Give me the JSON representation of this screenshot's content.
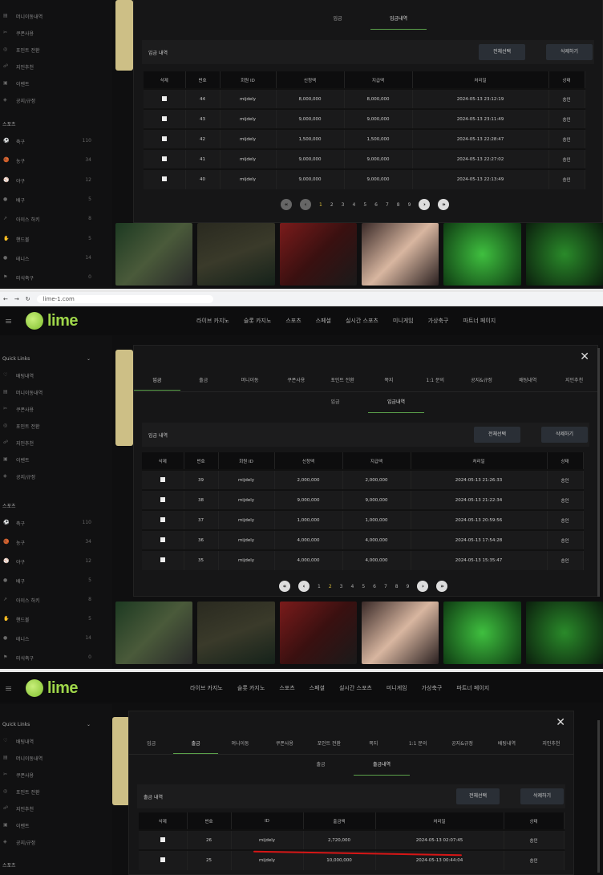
{
  "browser": {
    "url": "lime-1.com"
  },
  "brand": {
    "name": "lime"
  },
  "topnav": [
    "라이브 카지노",
    "슬롯 카지노",
    "스포츠",
    "스페셜",
    "실시간 스포츠",
    "미니게임",
    "가상축구",
    "파트너 페이지"
  ],
  "sidebar": {
    "quick_links": "Quick Links",
    "links": [
      "배팅내역",
      "머니이동내역",
      "쿠폰사용",
      "포인트 전환",
      "지인추천",
      "이벤트",
      "공지/규정"
    ],
    "sports_header": "스포츠",
    "sports": [
      {
        "name": "축구",
        "count": "110"
      },
      {
        "name": "농구",
        "count": "34"
      },
      {
        "name": "야구",
        "count": "12"
      },
      {
        "name": "배구",
        "count": "5"
      },
      {
        "name": "아이스 하키",
        "count": "8"
      },
      {
        "name": "핸드볼",
        "count": "5"
      },
      {
        "name": "테니스",
        "count": "14"
      },
      {
        "name": "미식축구",
        "count": "0"
      }
    ]
  },
  "modal_tabs": [
    "입금",
    "출금",
    "머니이동",
    "쿠폰사용",
    "포인트 전환",
    "쪽지",
    "1:1 문의",
    "공지&규정",
    "배팅내역",
    "지인추천"
  ],
  "deposit": {
    "subtabs": [
      "입금",
      "입금내역"
    ],
    "card_title": "입금 내역",
    "select_all": "전체선택",
    "delete": "삭제하기",
    "columns": [
      "삭제",
      "번호",
      "회원 ID",
      "신청액",
      "지급액",
      "처리일",
      "상태"
    ]
  },
  "panel1_rows": [
    {
      "no": "44",
      "id": "mijdely",
      "req": "8,000,000",
      "paid": "8,000,000",
      "date": "2024-05-13 23:12:19",
      "status": "승인"
    },
    {
      "no": "43",
      "id": "mijdely",
      "req": "9,000,000",
      "paid": "9,000,000",
      "date": "2024-05-13 23:11:49",
      "status": "승인"
    },
    {
      "no": "42",
      "id": "mijdely",
      "req": "1,500,000",
      "paid": "1,500,000",
      "date": "2024-05-13 22:28:47",
      "status": "승인"
    },
    {
      "no": "41",
      "id": "mijdely",
      "req": "9,000,000",
      "paid": "9,000,000",
      "date": "2024-05-13 22:27:02",
      "status": "승인"
    },
    {
      "no": "40",
      "id": "mijdely",
      "req": "9,000,000",
      "paid": "9,000,000",
      "date": "2024-05-13 22:13:49",
      "status": "승인"
    }
  ],
  "panel2_rows": [
    {
      "no": "39",
      "id": "mijdely",
      "req": "2,000,000",
      "paid": "2,000,000",
      "date": "2024-05-13 21:26:33",
      "status": "승인"
    },
    {
      "no": "38",
      "id": "mijdely",
      "req": "9,000,000",
      "paid": "9,000,000",
      "date": "2024-05-13 21:22:34",
      "status": "승인"
    },
    {
      "no": "37",
      "id": "mijdely",
      "req": "1,000,000",
      "paid": "1,000,000",
      "date": "2024-05-13 20:59:56",
      "status": "승인"
    },
    {
      "no": "36",
      "id": "mijdely",
      "req": "4,000,000",
      "paid": "4,000,000",
      "date": "2024-05-13 17:54:28",
      "status": "승인"
    },
    {
      "no": "35",
      "id": "mijdely",
      "req": "4,000,000",
      "paid": "4,000,000",
      "date": "2024-05-13 15:35:47",
      "status": "승인"
    }
  ],
  "pages": [
    "1",
    "2",
    "3",
    "4",
    "5",
    "6",
    "7",
    "8",
    "9"
  ],
  "panel1_current_page": "1",
  "panel2_current_page": "2",
  "withdraw": {
    "subtabs": [
      "출금",
      "출금내역"
    ],
    "card_title": "출금 내역",
    "select_all": "전체선택",
    "delete": "삭제하기",
    "columns": [
      "삭제",
      "번호",
      "ID",
      "출금액",
      "처리일",
      "상태"
    ],
    "rows": [
      {
        "no": "26",
        "id": "mijdely",
        "amount": "2,720,000",
        "date": "2024-05-13 02:07:45",
        "status": "승인"
      },
      {
        "no": "25",
        "id": "mijdely",
        "amount": "10,000,000",
        "date": "2024-05-13 00:44:04",
        "status": "승인"
      }
    ]
  },
  "colors": {
    "accent": "#5aa04a",
    "brand": "#9fd64a",
    "highlight": "#d61616",
    "current_page": "#d5b93a"
  }
}
